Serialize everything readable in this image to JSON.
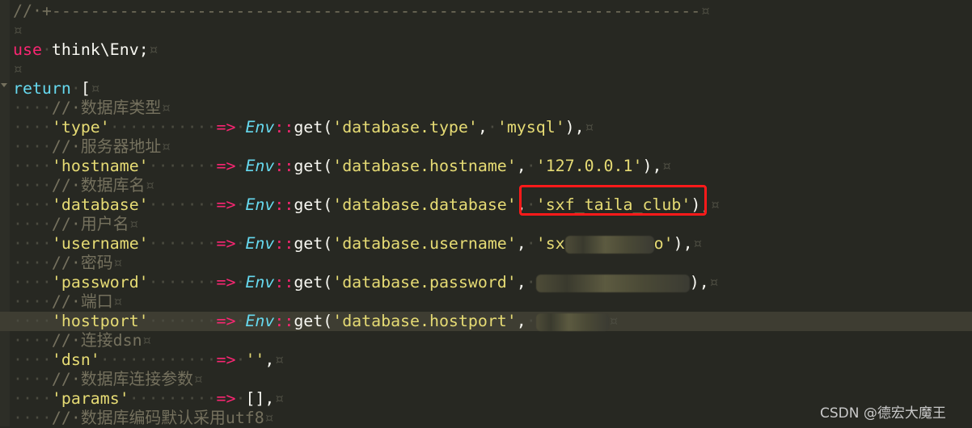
{
  "editor": {
    "lines": [
      [
        [
          "c",
          "//·+-------------------------------------------------------------------"
        ],
        [
          "ws",
          "¤"
        ]
      ],
      [
        [
          "ws",
          "¤"
        ]
      ],
      [
        [
          "k",
          "use"
        ],
        [
          "ws",
          "·"
        ],
        [
          "p",
          "think\\Env;"
        ],
        [
          "ws",
          "¤"
        ]
      ],
      [
        [
          "ws",
          "¤"
        ]
      ],
      [
        [
          "f",
          "return"
        ],
        [
          "ws",
          "·"
        ],
        [
          "p",
          "["
        ],
        [
          "ws",
          "¤"
        ]
      ],
      [
        [
          "ws",
          "····"
        ],
        [
          "c",
          "//·数据库类型"
        ],
        [
          "ws",
          "¤"
        ]
      ],
      [
        [
          "ws",
          "····"
        ],
        [
          "s",
          "'type'"
        ],
        [
          "ws",
          "···········"
        ],
        [
          "k",
          "=>"
        ],
        [
          "ws",
          "·"
        ],
        [
          "e",
          "Env"
        ],
        [
          "k",
          "::"
        ],
        [
          "p",
          "get("
        ],
        [
          "s",
          "'database.type'"
        ],
        [
          "p",
          ","
        ],
        [
          "ws",
          "·"
        ],
        [
          "s",
          "'mysql'"
        ],
        [
          "p",
          "),"
        ],
        [
          "ws",
          "¤"
        ]
      ],
      [
        [
          "ws",
          "····"
        ],
        [
          "c",
          "//·服务器地址"
        ],
        [
          "ws",
          "¤"
        ]
      ],
      [
        [
          "ws",
          "····"
        ],
        [
          "s",
          "'hostname'"
        ],
        [
          "ws",
          "·······"
        ],
        [
          "k",
          "=>"
        ],
        [
          "ws",
          "·"
        ],
        [
          "e",
          "Env"
        ],
        [
          "k",
          "::"
        ],
        [
          "p",
          "get("
        ],
        [
          "s",
          "'database.hostname'"
        ],
        [
          "p",
          ","
        ],
        [
          "ws",
          "·"
        ],
        [
          "s",
          "'127.0.0.1'"
        ],
        [
          "p",
          "),"
        ],
        [
          "ws",
          "¤"
        ]
      ],
      [
        [
          "ws",
          "····"
        ],
        [
          "c",
          "//·数据库名"
        ],
        [
          "ws",
          "¤"
        ]
      ],
      [
        [
          "ws",
          "····"
        ],
        [
          "s",
          "'database'"
        ],
        [
          "ws",
          "·······"
        ],
        [
          "k",
          "=>"
        ],
        [
          "ws",
          "·"
        ],
        [
          "e",
          "Env"
        ],
        [
          "k",
          "::"
        ],
        [
          "p",
          "get("
        ],
        [
          "s",
          "'database.database'"
        ],
        [
          "p",
          ","
        ],
        [
          "ws",
          "·"
        ],
        [
          "s",
          "'sxf_taila_club'"
        ],
        [
          "p",
          "),"
        ],
        [
          "ws",
          "¤"
        ]
      ],
      [
        [
          "ws",
          "····"
        ],
        [
          "c",
          "//·用户名"
        ],
        [
          "ws",
          "¤"
        ]
      ],
      [
        [
          "ws",
          "····"
        ],
        [
          "s",
          "'username'"
        ],
        [
          "ws",
          "·······"
        ],
        [
          "k",
          "=>"
        ],
        [
          "ws",
          "·"
        ],
        [
          "e",
          "Env"
        ],
        [
          "k",
          "::"
        ],
        [
          "p",
          "get("
        ],
        [
          "s",
          "'database.username'"
        ],
        [
          "p",
          ","
        ],
        [
          "ws",
          "·"
        ],
        [
          "s",
          "'sx"
        ],
        [
          "r",
          ""
        ],
        [
          "s",
          "o'"
        ],
        [
          "p",
          "),"
        ],
        [
          "ws",
          "¤"
        ]
      ],
      [
        [
          "ws",
          "····"
        ],
        [
          "c",
          "//·密码"
        ],
        [
          "ws",
          "¤"
        ]
      ],
      [
        [
          "ws",
          "····"
        ],
        [
          "s",
          "'password'"
        ],
        [
          "ws",
          "·······"
        ],
        [
          "k",
          "=>"
        ],
        [
          "ws",
          "·"
        ],
        [
          "e",
          "Env"
        ],
        [
          "k",
          "::"
        ],
        [
          "p",
          "get("
        ],
        [
          "s",
          "'database.password'"
        ],
        [
          "p",
          ","
        ],
        [
          "ws",
          "·"
        ],
        [
          "r",
          ""
        ],
        [
          "p",
          "),"
        ],
        [
          "ws",
          "¤"
        ]
      ],
      [
        [
          "ws",
          "····"
        ],
        [
          "c",
          "//·端口"
        ],
        [
          "ws",
          "¤"
        ]
      ],
      [
        [
          "ws",
          "····"
        ],
        [
          "s",
          "'hostport'"
        ],
        [
          "ws",
          "·······"
        ],
        [
          "k",
          "=>"
        ],
        [
          "ws",
          "·"
        ],
        [
          "e",
          "Env"
        ],
        [
          "k",
          "::"
        ],
        [
          "p",
          "get("
        ],
        [
          "s",
          "'database.hostport'"
        ],
        [
          "p",
          ","
        ],
        [
          "ws",
          "·"
        ],
        [
          "r",
          ""
        ],
        [
          "ws",
          "¤"
        ]
      ],
      [
        [
          "ws",
          "····"
        ],
        [
          "c",
          "//·连接dsn"
        ],
        [
          "ws",
          "¤"
        ]
      ],
      [
        [
          "ws",
          "····"
        ],
        [
          "s",
          "'dsn'"
        ],
        [
          "ws",
          "············"
        ],
        [
          "k",
          "=>"
        ],
        [
          "ws",
          "·"
        ],
        [
          "s",
          "''"
        ],
        [
          "p",
          ","
        ],
        [
          "ws",
          "¤"
        ]
      ],
      [
        [
          "ws",
          "····"
        ],
        [
          "c",
          "//·数据库连接参数"
        ],
        [
          "ws",
          "¤"
        ]
      ],
      [
        [
          "ws",
          "····"
        ],
        [
          "s",
          "'params'"
        ],
        [
          "ws",
          "·········"
        ],
        [
          "k",
          "=>"
        ],
        [
          "ws",
          "·"
        ],
        [
          "p",
          "[],"
        ],
        [
          "ws",
          "¤"
        ]
      ],
      [
        [
          "ws",
          "····"
        ],
        [
          "c",
          "//·数据库编码默认采用utf8"
        ],
        [
          "ws",
          "¤"
        ]
      ]
    ],
    "current_line": 16,
    "highlighted_value": "'sxf_taila_club'),"
  },
  "watermark": "CSDN @德宏大魔王",
  "colors": {
    "background": "#272822",
    "comment": "#75715e",
    "keyword": "#f92672",
    "class": "#66d9ef",
    "string": "#e6db74",
    "text": "#f8f8f2",
    "highlight_box": "#ff1a1a"
  }
}
